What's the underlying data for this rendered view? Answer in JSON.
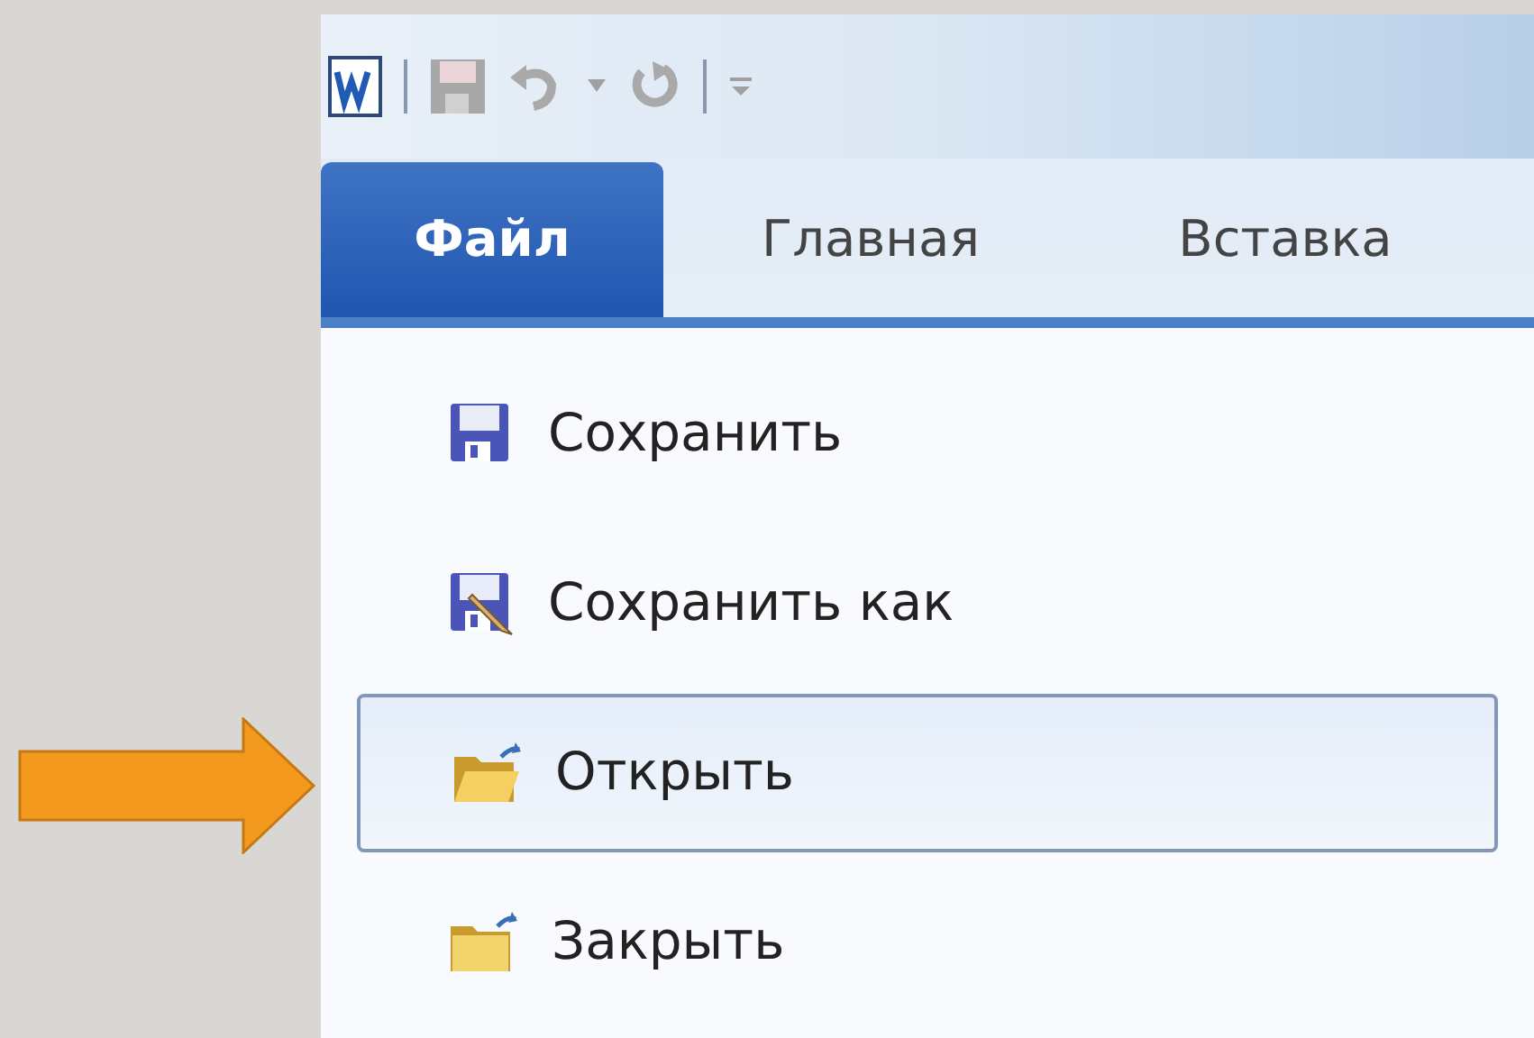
{
  "tabs": [
    {
      "label": "Файл",
      "selected": true
    },
    {
      "label": "Главная",
      "selected": false
    },
    {
      "label": "Вставка",
      "selected": false
    }
  ],
  "menu": [
    {
      "kind": "save",
      "label": "Сохранить",
      "selected": false
    },
    {
      "kind": "save_as",
      "label": "Сохранить как",
      "selected": false
    },
    {
      "kind": "open",
      "label": "Открыть",
      "selected": true
    },
    {
      "kind": "close",
      "label": "Закрыть",
      "selected": false
    }
  ]
}
